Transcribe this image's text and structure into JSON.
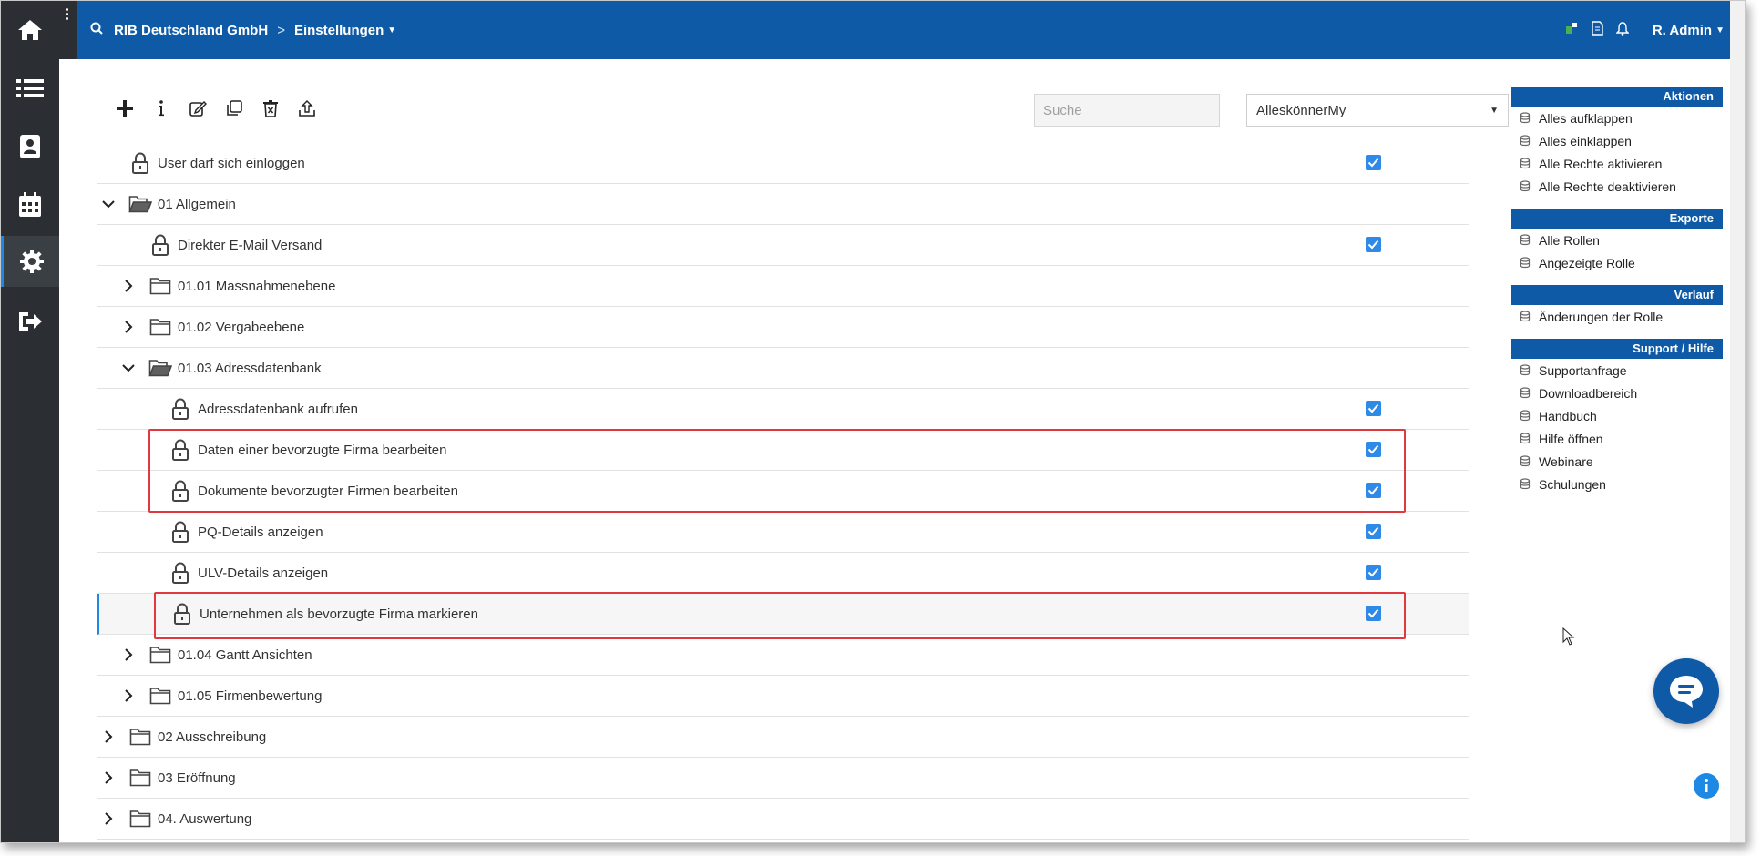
{
  "header": {
    "company": "RIB Deutschland GmbH",
    "separator": ">",
    "section": "Einstellungen",
    "user": "R. Admin"
  },
  "sidebar": {
    "items": [
      {
        "icon": "home-icon"
      },
      {
        "icon": "list-icon"
      },
      {
        "icon": "contacts-icon"
      },
      {
        "icon": "calendar-icon"
      },
      {
        "icon": "gear-icon"
      },
      {
        "icon": "logout-icon"
      }
    ]
  },
  "toolbar": {
    "icons": [
      "plus-icon",
      "info-icon",
      "edit-icon",
      "copy-icon",
      "delete-icon",
      "upload-icon"
    ]
  },
  "search": {
    "placeholder": "Suche",
    "value": ""
  },
  "role_select": {
    "value": "AlleskönnerMy"
  },
  "tree": {
    "rows": [
      {
        "label": "User darf sich einloggen",
        "type": "lock",
        "level": 0,
        "checked": true
      },
      {
        "label": "01 Allgemein",
        "type": "folder-open",
        "level": 0,
        "expanded": true
      },
      {
        "label": "Direkter E-Mail Versand",
        "type": "lock",
        "level": 1,
        "checked": true
      },
      {
        "label": "01.01 Massnahmenebene",
        "type": "folder",
        "level": 1,
        "expanded": false
      },
      {
        "label": "01.02 Vergabeebene",
        "type": "folder",
        "level": 1,
        "expanded": false
      },
      {
        "label": "01.03 Adressdatenbank",
        "type": "folder-open",
        "level": 1,
        "expanded": true
      },
      {
        "label": "Adressdatenbank aufrufen",
        "type": "lock",
        "level": 2,
        "checked": true
      },
      {
        "label": "Daten einer bevorzugte Firma bearbeiten",
        "type": "lock",
        "level": 2,
        "checked": true
      },
      {
        "label": "Dokumente bevorzugter Firmen bearbeiten",
        "type": "lock",
        "level": 2,
        "checked": true
      },
      {
        "label": "PQ-Details anzeigen",
        "type": "lock",
        "level": 2,
        "checked": true
      },
      {
        "label": "ULV-Details anzeigen",
        "type": "lock",
        "level": 2,
        "checked": true
      },
      {
        "label": "Unternehmen als bevorzugte Firma markieren",
        "type": "lock",
        "level": 2,
        "checked": true
      },
      {
        "label": "01.04 Gantt Ansichten",
        "type": "folder",
        "level": 1,
        "expanded": false
      },
      {
        "label": "01.05 Firmenbewertung",
        "type": "folder",
        "level": 1,
        "expanded": false
      },
      {
        "label": "02 Ausschreibung",
        "type": "folder",
        "level": 0,
        "expanded": false
      },
      {
        "label": "03 Eröffnung",
        "type": "folder",
        "level": 0,
        "expanded": false
      },
      {
        "label": "04. Auswertung",
        "type": "folder",
        "level": 0,
        "expanded": false
      }
    ]
  },
  "rightpanel": {
    "sections": [
      {
        "title": "Aktionen",
        "items": [
          "Alles aufklappen",
          "Alles einklappen",
          "Alle Rechte aktivieren",
          "Alle Rechte deaktivieren"
        ]
      },
      {
        "title": "Exporte",
        "items": [
          "Alle Rollen",
          "Angezeigte Rolle"
        ]
      },
      {
        "title": "Verlauf",
        "items": [
          "Änderungen der Rolle"
        ]
      },
      {
        "title": "Support / Hilfe",
        "items": [
          "Supportanfrage",
          "Downloadbereich",
          "Handbuch",
          "Hilfe öffnen",
          "Webinare",
          "Schulungen"
        ]
      }
    ]
  },
  "colors": {
    "brand_blue": "#0e5aa7",
    "checkbox_blue": "#2e8ae6",
    "highlight_red": "#e0383e",
    "sidebar_dark": "#2b2f33"
  }
}
